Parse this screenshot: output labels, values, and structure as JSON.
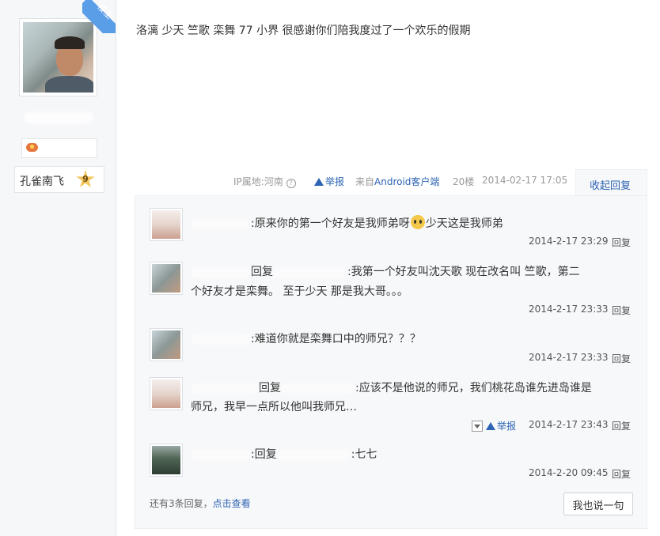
{
  "author": {
    "corner_badge": "楼主",
    "username": "孔雀南飞",
    "level": "9"
  },
  "post": {
    "content": "洛漓 少天 竺歌 栾舞 77 小界 很感谢你们陪我度过了一个欢乐的假期",
    "ip": "IP属地:河南",
    "report": "举报",
    "source_prefix": "来自",
    "source_link": "Android客户端",
    "floor": "20楼",
    "datetime": "2014-02-17 17:05",
    "collapse_label": "收起回复"
  },
  "replies": [
    {
      "text_a": ":原来你的第一个好友是我师弟呀",
      "text_b": "少天这是我师弟",
      "time": "2014-2-17 23:29",
      "reply_label": "回复"
    },
    {
      "text_a": "回复",
      "text_b": ":我第一个好友叫沈天歌 现在改名叫 竺歌，第二",
      "text_c": "个好友才是栾舞。 至于少天 那是我大哥。。。",
      "time": "2014-2-17 23:33",
      "reply_label": "回复"
    },
    {
      "text_a": ":难道你就是栾舞口中的师兄？？？",
      "time": "2014-2-17 23:33",
      "reply_label": "回复"
    },
    {
      "text_a": "回复",
      "text_b": ":应该不是他说的师兄，我们桃花岛谁先进岛谁是",
      "text_c": "师兄，我早一点所以他叫我师兄…",
      "report": "举报",
      "time": "2014-2-17 23:43",
      "reply_label": "回复"
    },
    {
      "text_a": ":回复",
      "text_b": ":七七",
      "time": "2014-2-20 09:45",
      "reply_label": "回复"
    }
  ],
  "footer": {
    "more_prefix": "还有3条回复，",
    "more_link": "点击查看",
    "say_button": "我也说一句"
  }
}
